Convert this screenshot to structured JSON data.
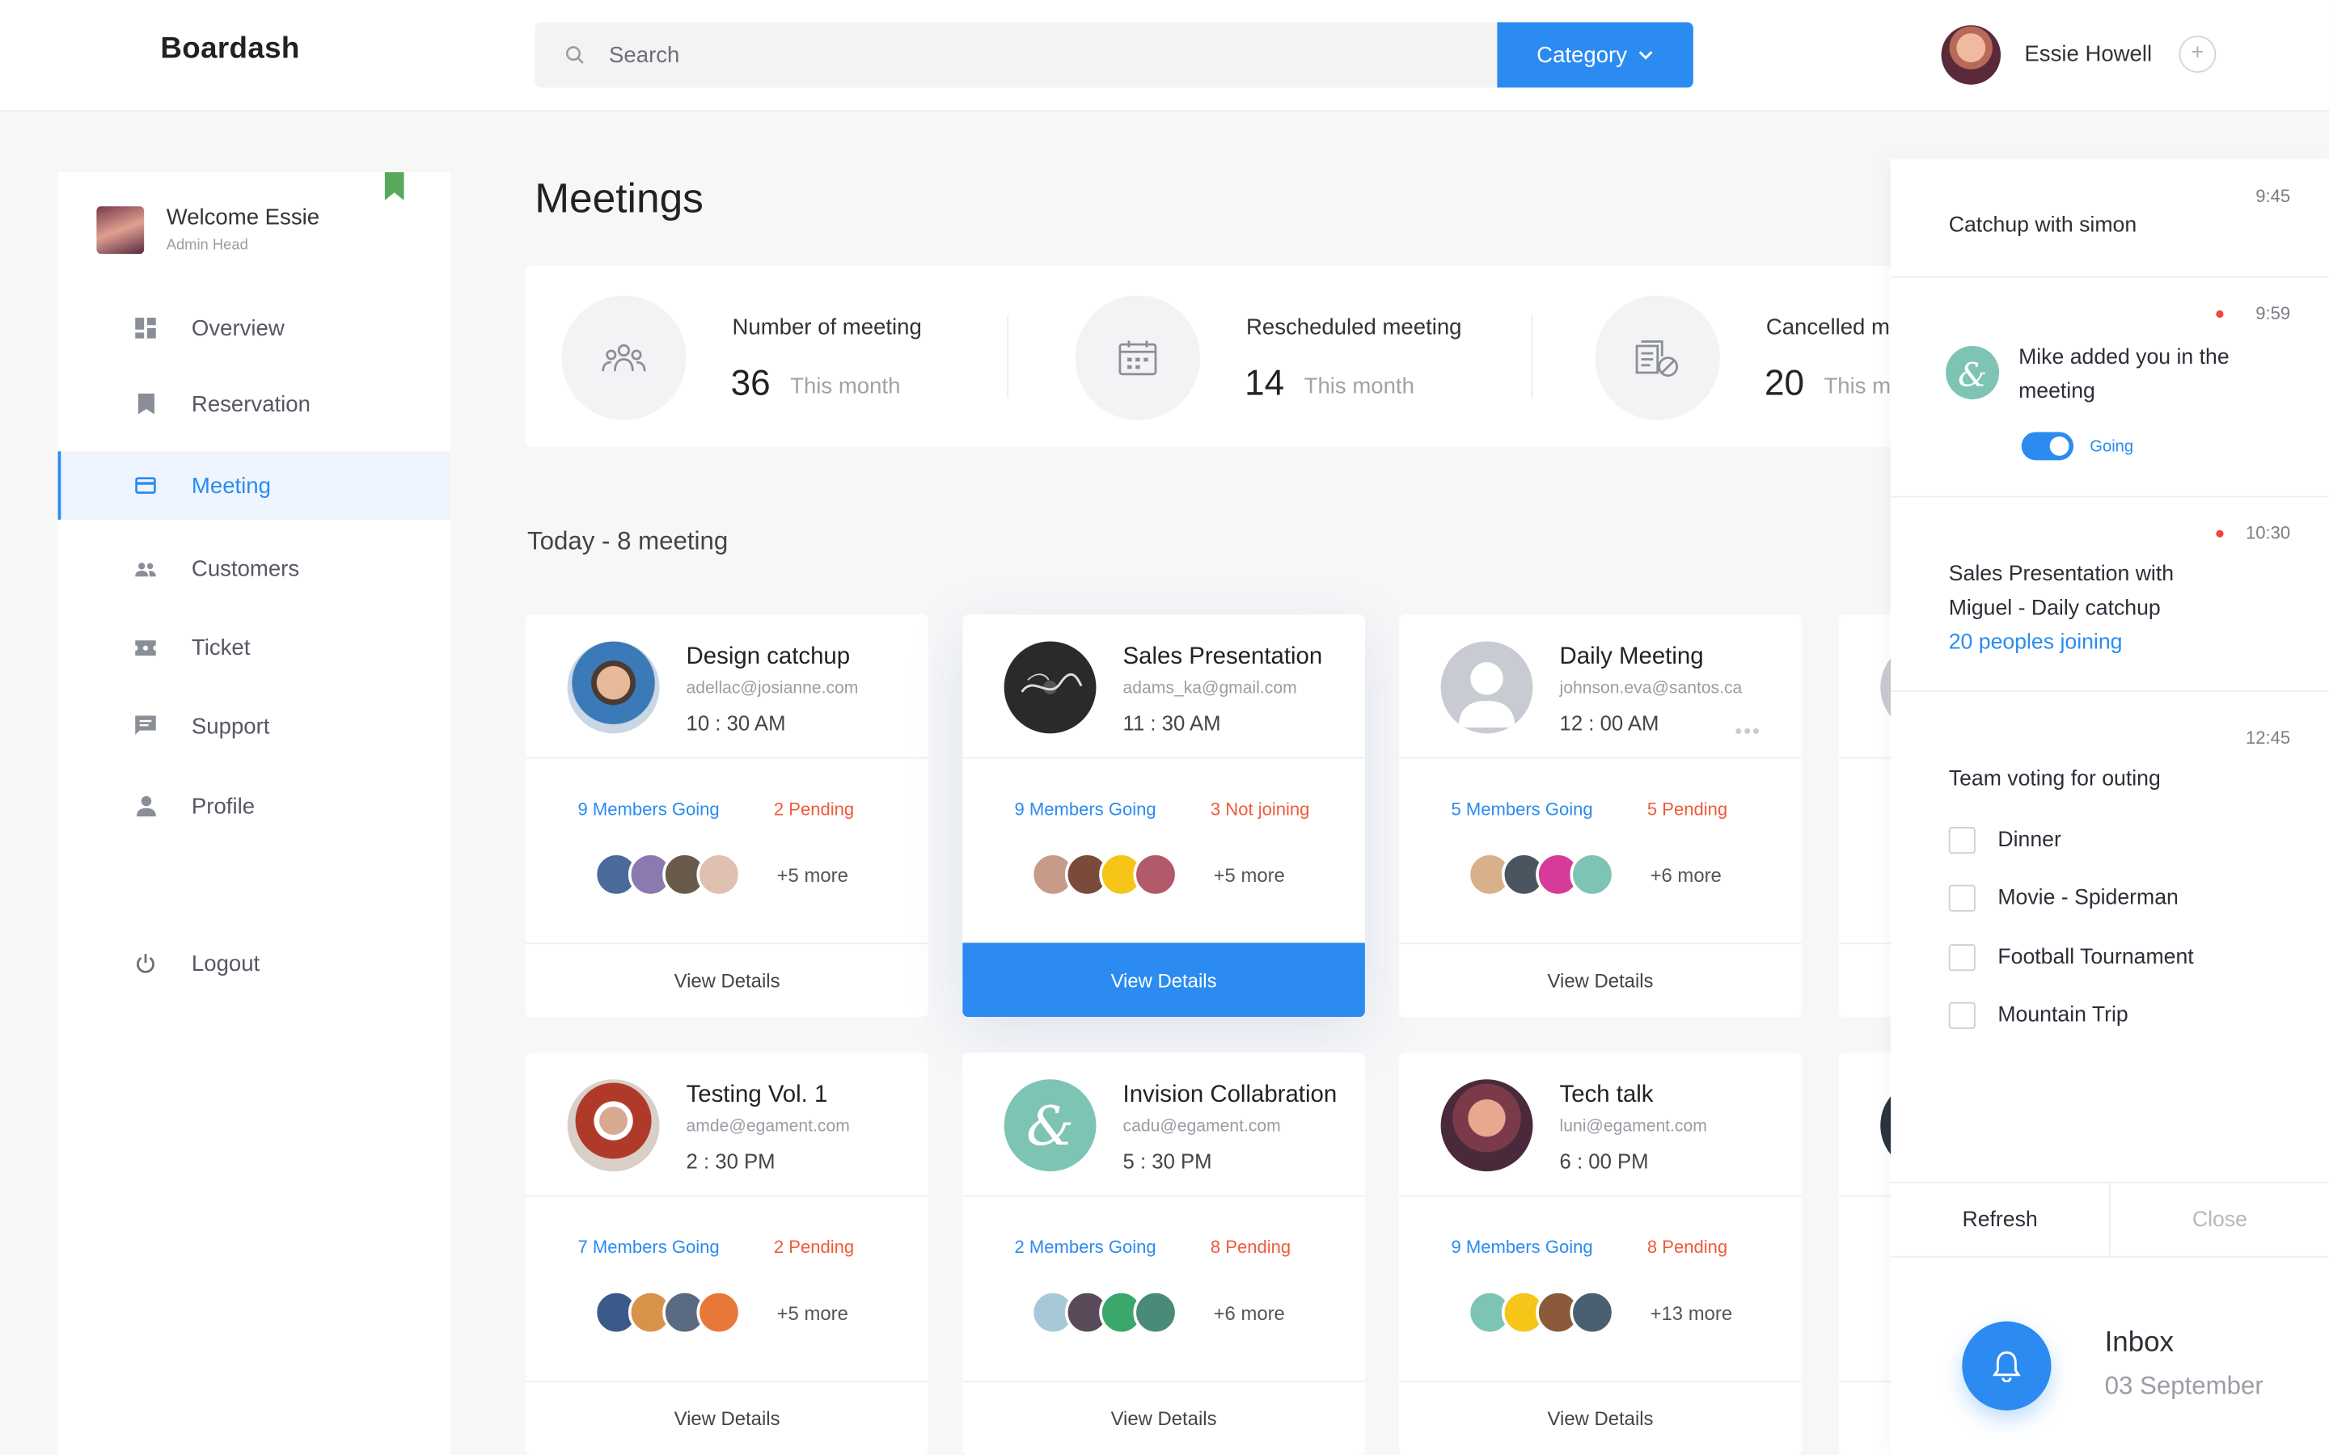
{
  "app": {
    "brand": "Boardash"
  },
  "header": {
    "search_placeholder": "Search",
    "category_label": "Category",
    "user_name": "Essie Howell",
    "plus_symbol": "+"
  },
  "sidebar": {
    "welcome_title": "Welcome Essie",
    "welcome_role": "Admin Head",
    "items": [
      {
        "label": "Overview",
        "icon": "grid-icon"
      },
      {
        "label": "Reservation",
        "icon": "bookmark-icon"
      },
      {
        "label": "Meeting",
        "icon": "card-icon",
        "active": true
      },
      {
        "label": "Customers",
        "icon": "people-icon"
      },
      {
        "label": "Ticket",
        "icon": "ticket-icon"
      },
      {
        "label": "Support",
        "icon": "chat-icon"
      },
      {
        "label": "Profile",
        "icon": "person-icon"
      }
    ],
    "logout_label": "Logout"
  },
  "page": {
    "title": "Meetings",
    "section_title": "Today - 8 meeting"
  },
  "stats": [
    {
      "label": "Number of meeting",
      "value": "36",
      "period": "This month",
      "icon": "group-icon"
    },
    {
      "label": "Rescheduled meeting",
      "value": "14",
      "period": "This month",
      "icon": "calendar-icon"
    },
    {
      "label": "Cancelled meeting",
      "value": "20",
      "period": "This month",
      "icon": "cancelled-doc-icon"
    }
  ],
  "cards": [
    {
      "title": "Design catchup",
      "email": "adellac@josianne.com",
      "time": "10 : 30 AM",
      "going": "9 Members Going",
      "pending": "2 Pending",
      "more": "+5 more",
      "button": "View Details"
    },
    {
      "title": "Sales Presentation",
      "email": "adams_ka@gmail.com",
      "time": "11 : 30 AM",
      "going": "9 Members Going",
      "pending": "3 Not joining",
      "more": "+5 more",
      "button": "View Details"
    },
    {
      "title": "Daily Meeting",
      "email": "johnson.eva@santos.ca",
      "time": "12 : 00 AM",
      "going": "5 Members Going",
      "pending": "5 Pending",
      "more": "+6 more",
      "button": "View Details",
      "options": "•••"
    },
    {
      "title": "Testing Vol. 1",
      "email": "amde@egament.com",
      "time": "2 : 30 PM",
      "going": "7 Members Going",
      "pending": "2 Pending",
      "more": "+5 more",
      "button": "View Details"
    },
    {
      "title": "Invision Collabration",
      "email": "cadu@egament.com",
      "time": "5 : 30 PM",
      "going": "2 Members Going",
      "pending": "8 Pending",
      "more": "+6 more",
      "button": "View Details"
    },
    {
      "title": "Tech talk",
      "email": "luni@egament.com",
      "time": "6 : 00 PM",
      "going": "9 Members Going",
      "pending": "8 Pending",
      "more": "+13 more",
      "button": "View Details"
    }
  ],
  "notifications": {
    "n1": {
      "time": "9:45",
      "text": "Catchup with simon"
    },
    "n2": {
      "time": "9:59",
      "text": "Mike added you in the meeting",
      "toggle_label": "Going"
    },
    "n3": {
      "time": "10:30",
      "text_line1": "Sales Presentation with",
      "text_line2": "Miguel  -  Daily catchup",
      "link": "20 peoples joining"
    },
    "n4": {
      "time": "12:45",
      "title": "Team voting for outing",
      "options": [
        "Dinner",
        "Movie - Spiderman",
        "Football Tournament",
        "Mountain Trip"
      ]
    },
    "refresh_label": "Refresh",
    "close_label": "Close"
  },
  "inbox": {
    "title": "Inbox",
    "date": "03 September"
  },
  "colors": {
    "accent": "#2b8bf0",
    "pending": "#f05a3a",
    "bookmark": "#5aa85e",
    "alert_dot": "#f0453a"
  }
}
